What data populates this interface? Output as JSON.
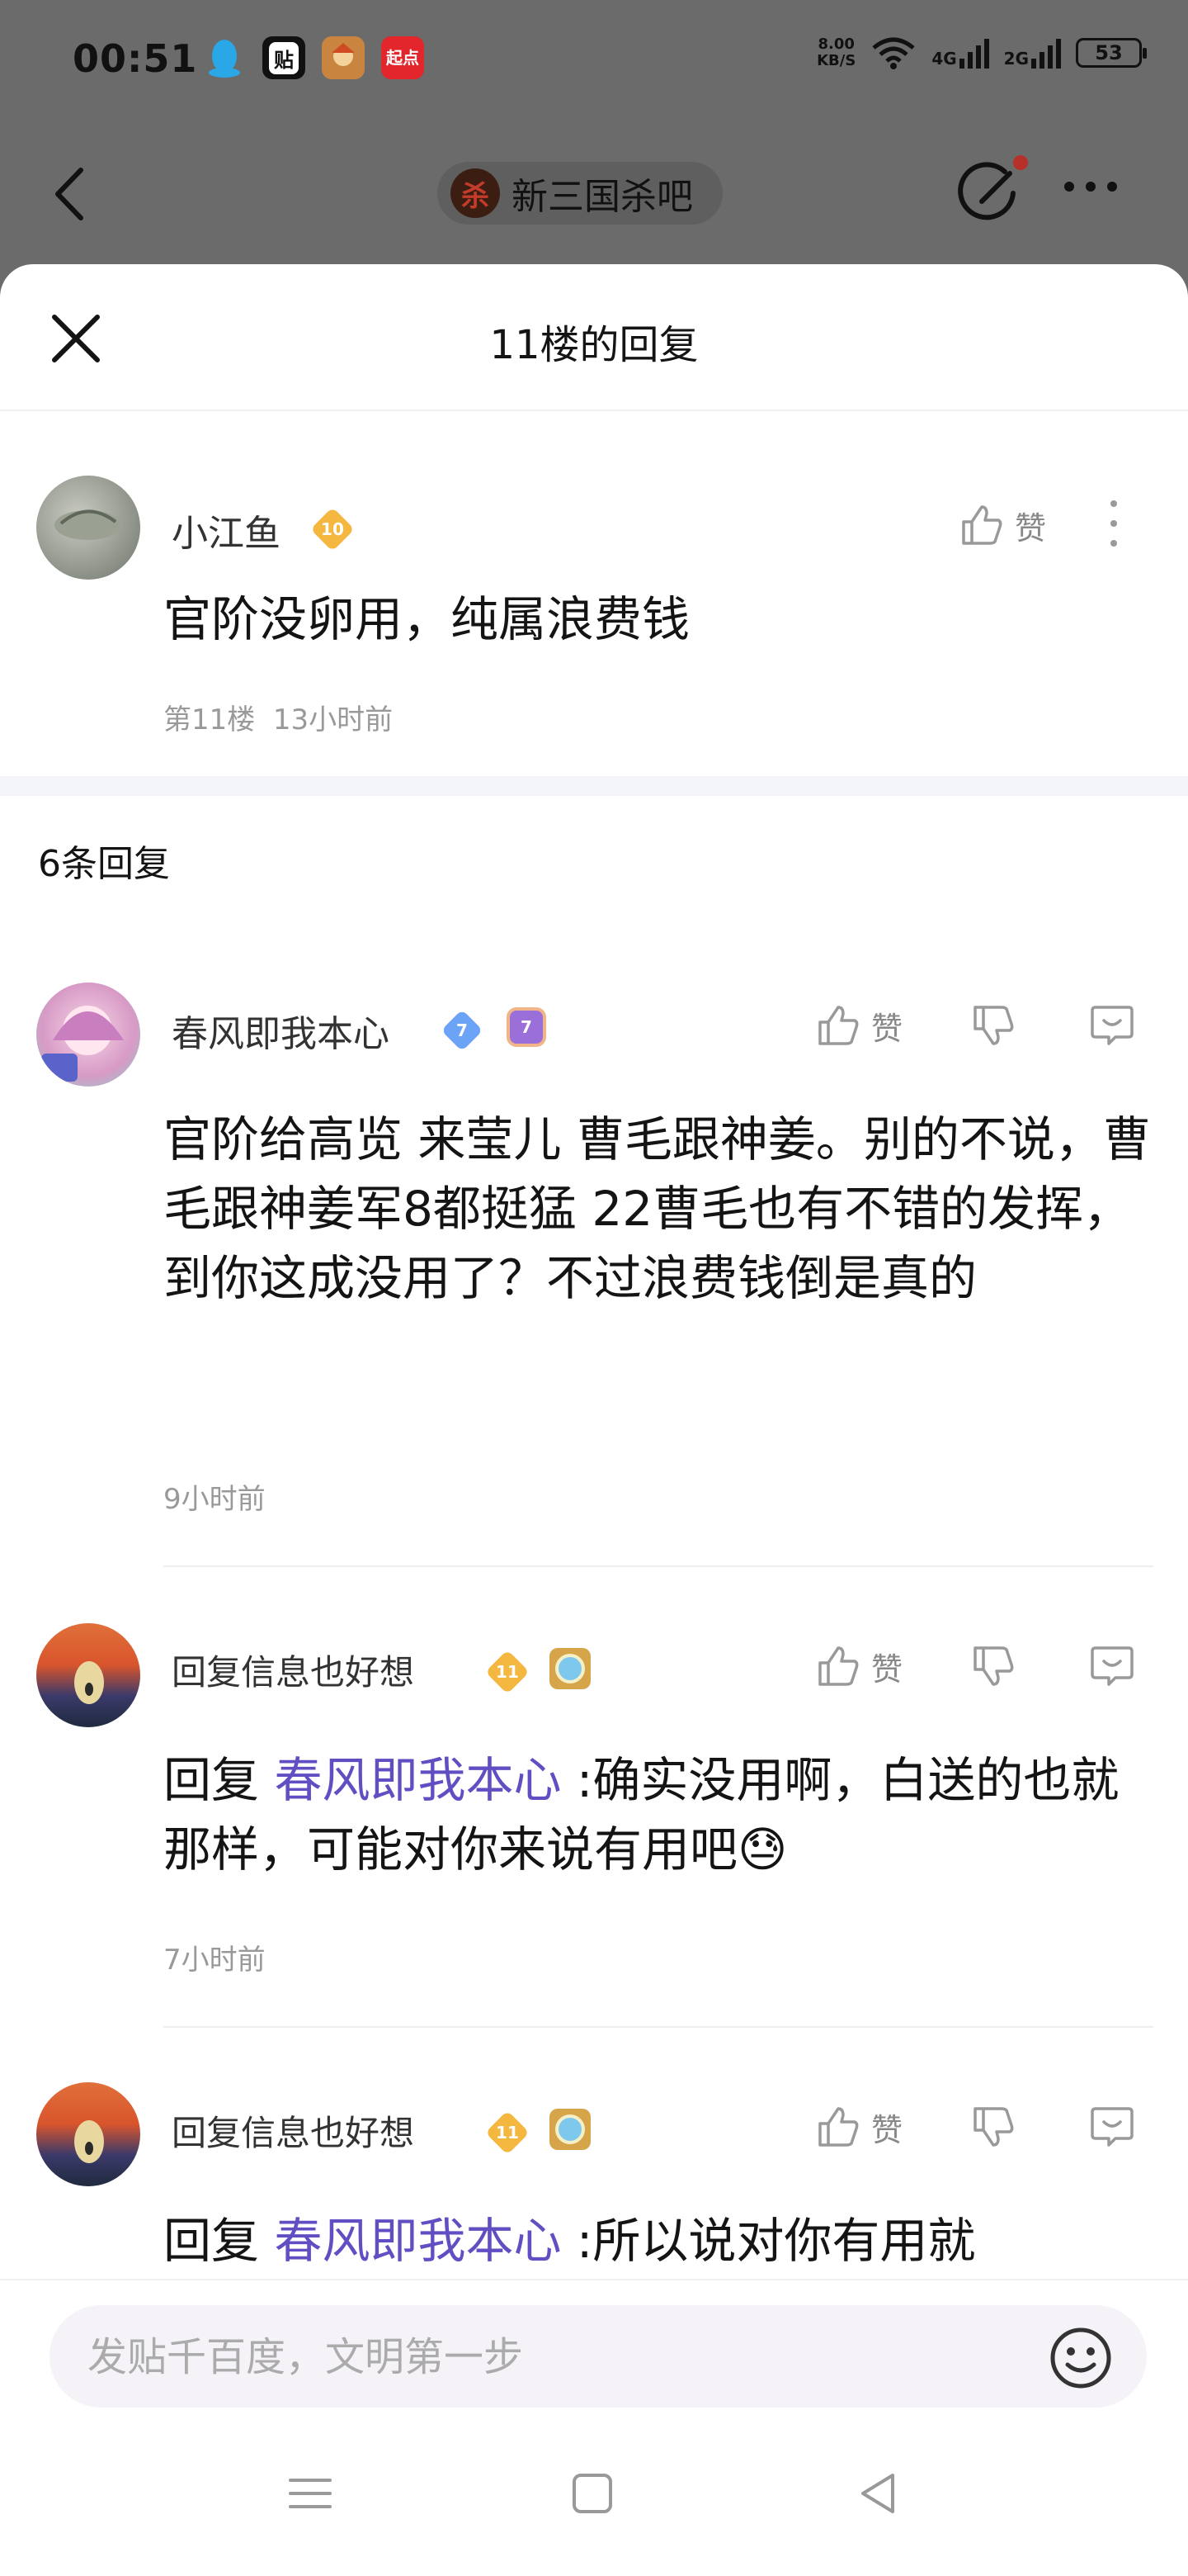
{
  "status_bar": {
    "time": "00:51",
    "net_speed_value": "8.00",
    "net_speed_unit": "KB/S",
    "sig1": "4G",
    "sig2": "2G",
    "battery": "53",
    "apps": [
      "qq-app-icon",
      "tieba-app-icon",
      "game-app-icon",
      "qidian-app-icon"
    ],
    "app_labels": [
      "",
      "贴",
      "",
      "起点"
    ]
  },
  "nav": {
    "forum_name": "新三国杀吧",
    "forum_logo_char": "杀"
  },
  "sheet": {
    "title": "11楼的回复"
  },
  "main_post": {
    "username": "小江鱼",
    "level": "10",
    "like_label": "赞",
    "content": "官阶没卵用，纯属浪费钱",
    "floor": "第11楼",
    "time": "13小时前"
  },
  "replies_header": "6条回复",
  "replies": [
    {
      "username": "春风即我本心",
      "level": "7",
      "badge2": "7",
      "like_label": "赞",
      "content": "官阶给高览 来莹儿 曹毛跟神姜。别的不说，曹毛跟神姜军8都挺猛 22曹毛也有不错的发挥，到你这成没用了？不过浪费钱倒是真的",
      "time": "9小时前"
    },
    {
      "username": "回复信息也好想",
      "level": "11",
      "like_label": "赞",
      "reply_prefix": "回复 ",
      "mention": "春风即我本心",
      "content": " :确实没用啊，白送的也就那样，可能对你来说有用吧",
      "emoji": "😓",
      "time": "7小时前"
    },
    {
      "username": "回复信息也好想",
      "level": "11",
      "like_label": "赞",
      "reply_prefix": "回复 ",
      "mention": "春风即我本心",
      "content": " :所以说对你有用就"
    }
  ],
  "input": {
    "placeholder": "发贴千百度，文明第一步"
  },
  "colors": {
    "accent": "#614ec2",
    "gold_badge": "#f4b740",
    "blue_badge": "#6ba3f7",
    "dim_overlay": "#6b6b6b"
  }
}
